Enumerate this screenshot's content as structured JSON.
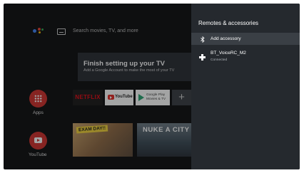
{
  "home": {
    "search_placeholder": "Search movies, TV, and more",
    "banner": {
      "title": "Finish setting up your TV",
      "subtitle": "Add a Google Account to make the most of your TV"
    },
    "apps_label": "Apps",
    "youtube_label": "YouTube",
    "tiles": {
      "netflix": "NETFLIX",
      "youtube": "YouTube",
      "play_store": "Google Play\nMovies & TV",
      "add": "+"
    },
    "thumbnails": {
      "first_badge": "EXAM DAY!!",
      "second_title": "NUKE A CITY"
    }
  },
  "panel": {
    "title": "Remotes & accessories",
    "add_accessory": "Add accessory",
    "device": {
      "name": "BT_VoiceRC_M2",
      "status": "Connected"
    }
  },
  "colors": {
    "accent_red": "#d0312d",
    "panel_bg": "#25292e",
    "selected_row": "#3a3f45"
  }
}
